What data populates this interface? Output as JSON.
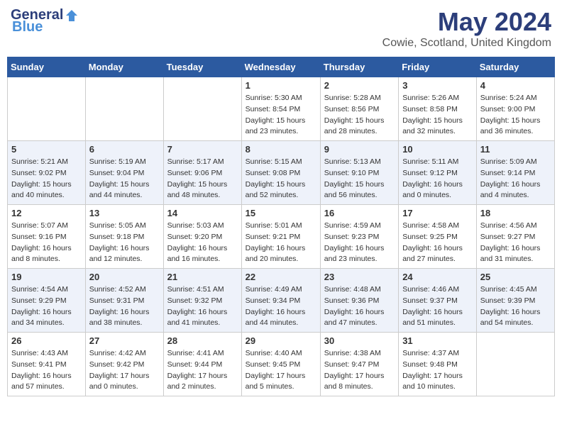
{
  "header": {
    "logo_general": "General",
    "logo_blue": "Blue",
    "month_year": "May 2024",
    "location": "Cowie, Scotland, United Kingdom"
  },
  "days_of_week": [
    "Sunday",
    "Monday",
    "Tuesday",
    "Wednesday",
    "Thursday",
    "Friday",
    "Saturday"
  ],
  "weeks": [
    [
      {
        "day": "",
        "info": ""
      },
      {
        "day": "",
        "info": ""
      },
      {
        "day": "",
        "info": ""
      },
      {
        "day": "1",
        "info": "Sunrise: 5:30 AM\nSunset: 8:54 PM\nDaylight: 15 hours\nand 23 minutes."
      },
      {
        "day": "2",
        "info": "Sunrise: 5:28 AM\nSunset: 8:56 PM\nDaylight: 15 hours\nand 28 minutes."
      },
      {
        "day": "3",
        "info": "Sunrise: 5:26 AM\nSunset: 8:58 PM\nDaylight: 15 hours\nand 32 minutes."
      },
      {
        "day": "4",
        "info": "Sunrise: 5:24 AM\nSunset: 9:00 PM\nDaylight: 15 hours\nand 36 minutes."
      }
    ],
    [
      {
        "day": "5",
        "info": "Sunrise: 5:21 AM\nSunset: 9:02 PM\nDaylight: 15 hours\nand 40 minutes."
      },
      {
        "day": "6",
        "info": "Sunrise: 5:19 AM\nSunset: 9:04 PM\nDaylight: 15 hours\nand 44 minutes."
      },
      {
        "day": "7",
        "info": "Sunrise: 5:17 AM\nSunset: 9:06 PM\nDaylight: 15 hours\nand 48 minutes."
      },
      {
        "day": "8",
        "info": "Sunrise: 5:15 AM\nSunset: 9:08 PM\nDaylight: 15 hours\nand 52 minutes."
      },
      {
        "day": "9",
        "info": "Sunrise: 5:13 AM\nSunset: 9:10 PM\nDaylight: 15 hours\nand 56 minutes."
      },
      {
        "day": "10",
        "info": "Sunrise: 5:11 AM\nSunset: 9:12 PM\nDaylight: 16 hours\nand 0 minutes."
      },
      {
        "day": "11",
        "info": "Sunrise: 5:09 AM\nSunset: 9:14 PM\nDaylight: 16 hours\nand 4 minutes."
      }
    ],
    [
      {
        "day": "12",
        "info": "Sunrise: 5:07 AM\nSunset: 9:16 PM\nDaylight: 16 hours\nand 8 minutes."
      },
      {
        "day": "13",
        "info": "Sunrise: 5:05 AM\nSunset: 9:18 PM\nDaylight: 16 hours\nand 12 minutes."
      },
      {
        "day": "14",
        "info": "Sunrise: 5:03 AM\nSunset: 9:20 PM\nDaylight: 16 hours\nand 16 minutes."
      },
      {
        "day": "15",
        "info": "Sunrise: 5:01 AM\nSunset: 9:21 PM\nDaylight: 16 hours\nand 20 minutes."
      },
      {
        "day": "16",
        "info": "Sunrise: 4:59 AM\nSunset: 9:23 PM\nDaylight: 16 hours\nand 23 minutes."
      },
      {
        "day": "17",
        "info": "Sunrise: 4:58 AM\nSunset: 9:25 PM\nDaylight: 16 hours\nand 27 minutes."
      },
      {
        "day": "18",
        "info": "Sunrise: 4:56 AM\nSunset: 9:27 PM\nDaylight: 16 hours\nand 31 minutes."
      }
    ],
    [
      {
        "day": "19",
        "info": "Sunrise: 4:54 AM\nSunset: 9:29 PM\nDaylight: 16 hours\nand 34 minutes."
      },
      {
        "day": "20",
        "info": "Sunrise: 4:52 AM\nSunset: 9:31 PM\nDaylight: 16 hours\nand 38 minutes."
      },
      {
        "day": "21",
        "info": "Sunrise: 4:51 AM\nSunset: 9:32 PM\nDaylight: 16 hours\nand 41 minutes."
      },
      {
        "day": "22",
        "info": "Sunrise: 4:49 AM\nSunset: 9:34 PM\nDaylight: 16 hours\nand 44 minutes."
      },
      {
        "day": "23",
        "info": "Sunrise: 4:48 AM\nSunset: 9:36 PM\nDaylight: 16 hours\nand 47 minutes."
      },
      {
        "day": "24",
        "info": "Sunrise: 4:46 AM\nSunset: 9:37 PM\nDaylight: 16 hours\nand 51 minutes."
      },
      {
        "day": "25",
        "info": "Sunrise: 4:45 AM\nSunset: 9:39 PM\nDaylight: 16 hours\nand 54 minutes."
      }
    ],
    [
      {
        "day": "26",
        "info": "Sunrise: 4:43 AM\nSunset: 9:41 PM\nDaylight: 16 hours\nand 57 minutes."
      },
      {
        "day": "27",
        "info": "Sunrise: 4:42 AM\nSunset: 9:42 PM\nDaylight: 17 hours\nand 0 minutes."
      },
      {
        "day": "28",
        "info": "Sunrise: 4:41 AM\nSunset: 9:44 PM\nDaylight: 17 hours\nand 2 minutes."
      },
      {
        "day": "29",
        "info": "Sunrise: 4:40 AM\nSunset: 9:45 PM\nDaylight: 17 hours\nand 5 minutes."
      },
      {
        "day": "30",
        "info": "Sunrise: 4:38 AM\nSunset: 9:47 PM\nDaylight: 17 hours\nand 8 minutes."
      },
      {
        "day": "31",
        "info": "Sunrise: 4:37 AM\nSunset: 9:48 PM\nDaylight: 17 hours\nand 10 minutes."
      },
      {
        "day": "",
        "info": ""
      }
    ]
  ]
}
